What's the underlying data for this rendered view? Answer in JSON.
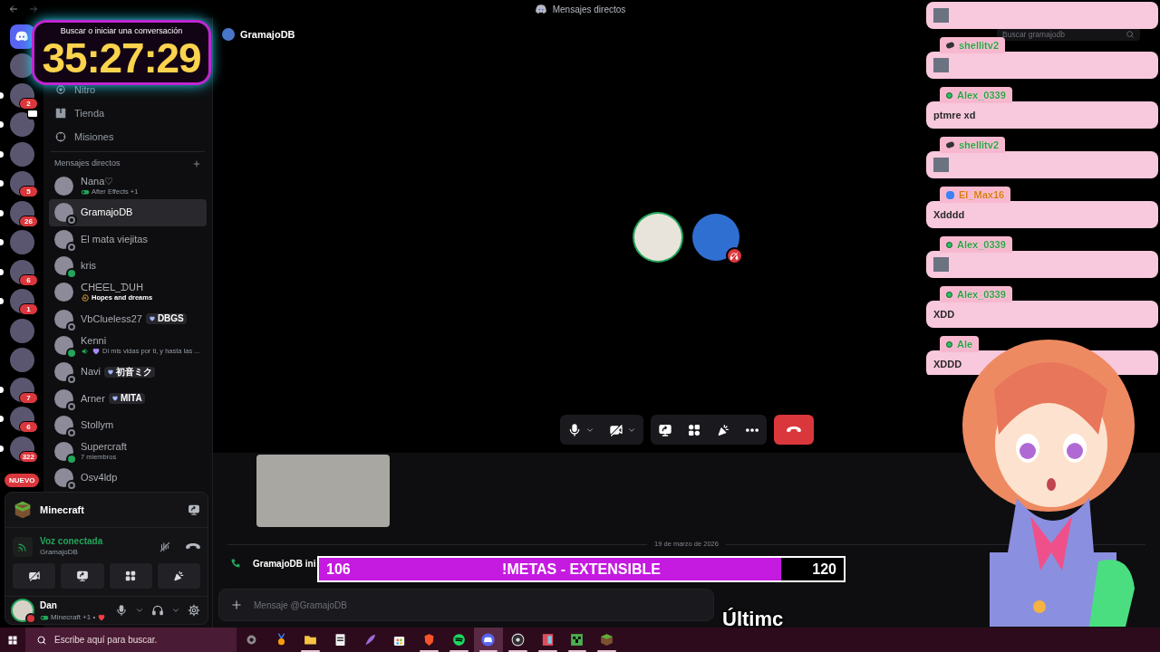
{
  "title_bar": {
    "title": "Mensajes directos"
  },
  "servers": [
    {
      "kind": "home",
      "unread": false
    },
    {
      "kind": "avatar",
      "unread": false
    },
    {
      "kind": "avatar",
      "unread": true,
      "badge": "2"
    },
    {
      "kind": "live",
      "unread": true
    },
    {
      "kind": "avatar",
      "unread": true
    },
    {
      "kind": "avatar",
      "unread": true,
      "badge": "5"
    },
    {
      "kind": "avatar",
      "unread": true,
      "badge": "26"
    },
    {
      "kind": "avatar",
      "unread": true
    },
    {
      "kind": "avatar",
      "unread": true,
      "badge": "6"
    },
    {
      "kind": "avatar",
      "unread": true,
      "badge": "1"
    },
    {
      "kind": "avatar",
      "unread": false
    },
    {
      "kind": "avatar",
      "unread": false
    },
    {
      "kind": "avatar",
      "unread": true,
      "badge": "7"
    },
    {
      "kind": "avatar",
      "unread": true,
      "badge": "6"
    },
    {
      "kind": "avatar",
      "unread": true,
      "badge": "322"
    }
  ],
  "new_pill": "NUEVO",
  "timer": {
    "search_hint": "Buscar o iniciar una conversación",
    "time": "35:27:29"
  },
  "nav": [
    {
      "kind": "nitro",
      "label": "Nitro"
    },
    {
      "kind": "shop",
      "label": "Tienda"
    },
    {
      "kind": "quests",
      "label": "Misiones"
    }
  ],
  "dm_header": "Mensajes directos",
  "dms": [
    {
      "name": "Nana♡",
      "selected": false,
      "activity": {
        "kind": "game",
        "text": "After Effects +1"
      }
    },
    {
      "name": "GramajoDB",
      "online": false,
      "selected": true
    },
    {
      "name": "El mata viejitas",
      "online": false,
      "selected": false
    },
    {
      "name": "kris",
      "online": true,
      "selected": false
    },
    {
      "name": "ᑕᕼᗴᗴᒪ_ᗪᑌᕼ",
      "selected": false,
      "activity": {
        "kind": "custom",
        "text": "Hopes and dreams"
      }
    },
    {
      "name": "VbClueless27",
      "online": false,
      "selected": false,
      "tag": "DBGS"
    },
    {
      "name": "Kenni",
      "online": true,
      "selected": false,
      "activity": {
        "kind": "voice",
        "text": "Di mis vidas por ti, y hasta las ..."
      }
    },
    {
      "name": "Navi",
      "online": false,
      "selected": false,
      "tag": "初音ミク"
    },
    {
      "name": "Arner",
      "online": false,
      "selected": false,
      "tag": "MITA"
    },
    {
      "name": "Stollym",
      "online": false,
      "selected": false
    },
    {
      "name": "Supercraft",
      "online": true,
      "selected": false,
      "activity": {
        "kind": "members",
        "text": "7 miembros"
      }
    },
    {
      "name": "Osv4ldp",
      "online": false,
      "selected": false
    }
  ],
  "panel": {
    "game": "Minecraft",
    "voice_status": "Voz conectada",
    "voice_channel": "GramajoDB",
    "user": {
      "name": "Dan",
      "activity": "Minecraft +1 •"
    }
  },
  "channel": {
    "title": "GramajoDB",
    "search_placeholder": "Buscar gramajodb"
  },
  "call": {
    "participants": [
      {
        "speaking": true,
        "deafened": false
      },
      {
        "speaking": false,
        "deafened": true
      }
    ]
  },
  "messages": {
    "date": "19 de marzo de 2026",
    "call_line": "GramajoDB ini",
    "placeholder": "Mensaje @GramajoDB"
  },
  "goal": {
    "current": "106",
    "label": "!METAS - EXTENSIBLE",
    "target": "120",
    "level": 0.88
  },
  "caption": "Últimc",
  "chat": [
    {
      "kind": "image"
    },
    {
      "name": "shellitv2",
      "badge": {
        "kind": "pill"
      },
      "color": "#2f9e44",
      "kind": "image"
    },
    {
      "name": "Alex_0339",
      "badge": {
        "kind": "dot"
      },
      "color": "#2f9e44",
      "kind": "text",
      "text": "ptmre xd"
    },
    {
      "name": "shellitv2",
      "badge": {
        "kind": "pill"
      },
      "color": "#2f9e44",
      "kind": "image"
    },
    {
      "name": "El_Max16",
      "badge": {
        "kind": "square"
      },
      "color": "#d9770f",
      "kind": "text",
      "text": "Xdddd"
    },
    {
      "name": "Alex_0339",
      "badge": {
        "kind": "dot"
      },
      "color": "#2f9e44",
      "kind": "image"
    },
    {
      "name": "Alex_0339",
      "badge": {
        "kind": "dot"
      },
      "color": "#2f9e44",
      "kind": "text",
      "text": "XDD"
    },
    {
      "name": "Ale",
      "badge": {
        "kind": "dot"
      },
      "color": "#2f9e44",
      "kind": "text",
      "text": "XDDD"
    }
  ],
  "taskbar": {
    "search_placeholder": "Escribe aquí para buscar.",
    "apps": [
      {
        "kind": "settings",
        "running": false,
        "selected": false
      },
      {
        "kind": "medal",
        "running": false,
        "selected": false
      },
      {
        "kind": "folder",
        "running": true,
        "selected": false
      },
      {
        "kind": "notepad",
        "running": false,
        "selected": false
      },
      {
        "kind": "feather",
        "running": false,
        "selected": false
      },
      {
        "kind": "store",
        "running": false,
        "selected": false
      },
      {
        "kind": "browser",
        "running": true,
        "selected": false
      },
      {
        "kind": "music",
        "running": true,
        "selected": false
      },
      {
        "kind": "chat",
        "running": true,
        "selected": true
      },
      {
        "kind": "recorder",
        "running": true,
        "selected": false
      },
      {
        "kind": "editor",
        "running": true,
        "selected": false
      },
      {
        "kind": "creeper",
        "running": true,
        "selected": false
      },
      {
        "kind": "block",
        "running": true,
        "selected": false
      }
    ]
  }
}
